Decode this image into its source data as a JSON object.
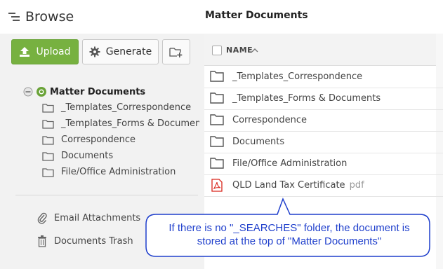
{
  "header": {
    "browse_title": "Browse",
    "matter_title": "Matter Documents"
  },
  "toolbar": {
    "upload_label": "Upload",
    "generate_label": "Generate"
  },
  "tree": {
    "root_label": "Matter Documents",
    "items": [
      {
        "label": "_Templates_Correspondence"
      },
      {
        "label": "_Templates_Forms & Documents"
      },
      {
        "label": "Correspondence"
      },
      {
        "label": "Documents"
      },
      {
        "label": "File/Office Administration"
      }
    ]
  },
  "side_links": {
    "email_attachments": "Email Attachments",
    "documents_trash": "Documents Trash"
  },
  "table": {
    "name_header": "NAME",
    "rows": [
      {
        "label": "_Templates_Correspondence",
        "type": "folder"
      },
      {
        "label": "_Templates_Forms & Documents",
        "type": "folder"
      },
      {
        "label": "Correspondence",
        "type": "folder"
      },
      {
        "label": "Documents",
        "type": "folder"
      },
      {
        "label": "File/Office Administration",
        "type": "folder"
      },
      {
        "label": "QLD Land Tax Certificate",
        "type": "pdf",
        "ext": "pdf"
      }
    ]
  },
  "callout": {
    "line1": "If there is no \"_SEARCHES\" folder, the document is",
    "line2": "stored at the top of \"Matter Documents\""
  },
  "colors": {
    "accent_green": "#77b140",
    "callout_text": "#1f3fcc",
    "pdf_red": "#d9261c"
  }
}
